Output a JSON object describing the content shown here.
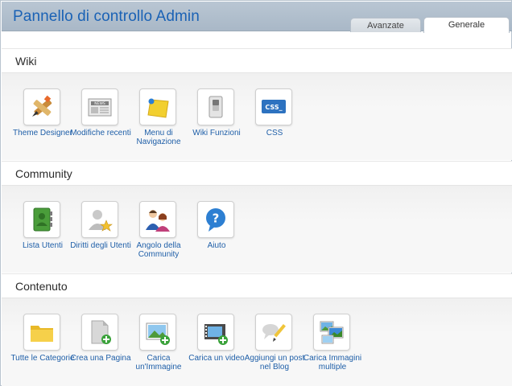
{
  "header": {
    "title": "Pannello di controllo Admin"
  },
  "tabs": [
    {
      "label": "Avanzate",
      "active": false
    },
    {
      "label": "Generale",
      "active": true
    }
  ],
  "sections": [
    {
      "title": "Wiki",
      "items": [
        {
          "label": "Theme Designer",
          "icon": "theme-designer-icon"
        },
        {
          "label": "Modifiche recenti",
          "icon": "news-icon"
        },
        {
          "label": "Menu di Navigazione",
          "icon": "navigation-menu-icon"
        },
        {
          "label": "Wiki Funzioni",
          "icon": "switch-icon"
        },
        {
          "label": "CSS",
          "icon": "css-icon"
        }
      ]
    },
    {
      "title": "Community",
      "items": [
        {
          "label": "Lista Utenti",
          "icon": "address-book-icon"
        },
        {
          "label": "Diritti degli Utenti",
          "icon": "user-star-icon"
        },
        {
          "label": "Angolo della Community",
          "icon": "community-people-icon"
        },
        {
          "label": "Aiuto",
          "icon": "help-bubble-icon"
        }
      ]
    },
    {
      "title": "Contenuto",
      "items": [
        {
          "label": "Tutte le Categorie",
          "icon": "folder-icon"
        },
        {
          "label": "Crea una Pagina",
          "icon": "page-add-icon"
        },
        {
          "label": "Carica un'Immagine",
          "icon": "image-add-icon"
        },
        {
          "label": "Carica un video",
          "icon": "video-add-icon"
        },
        {
          "label": "Aggiungi un post nel Blog",
          "icon": "blog-post-icon"
        },
        {
          "label": "Carica Immagini multiple",
          "icon": "multiple-images-icon"
        }
      ]
    }
  ],
  "colors": {
    "header_title": "#1a62b5",
    "link": "#1f5fa8",
    "header_bg": "#b4c2d0"
  }
}
